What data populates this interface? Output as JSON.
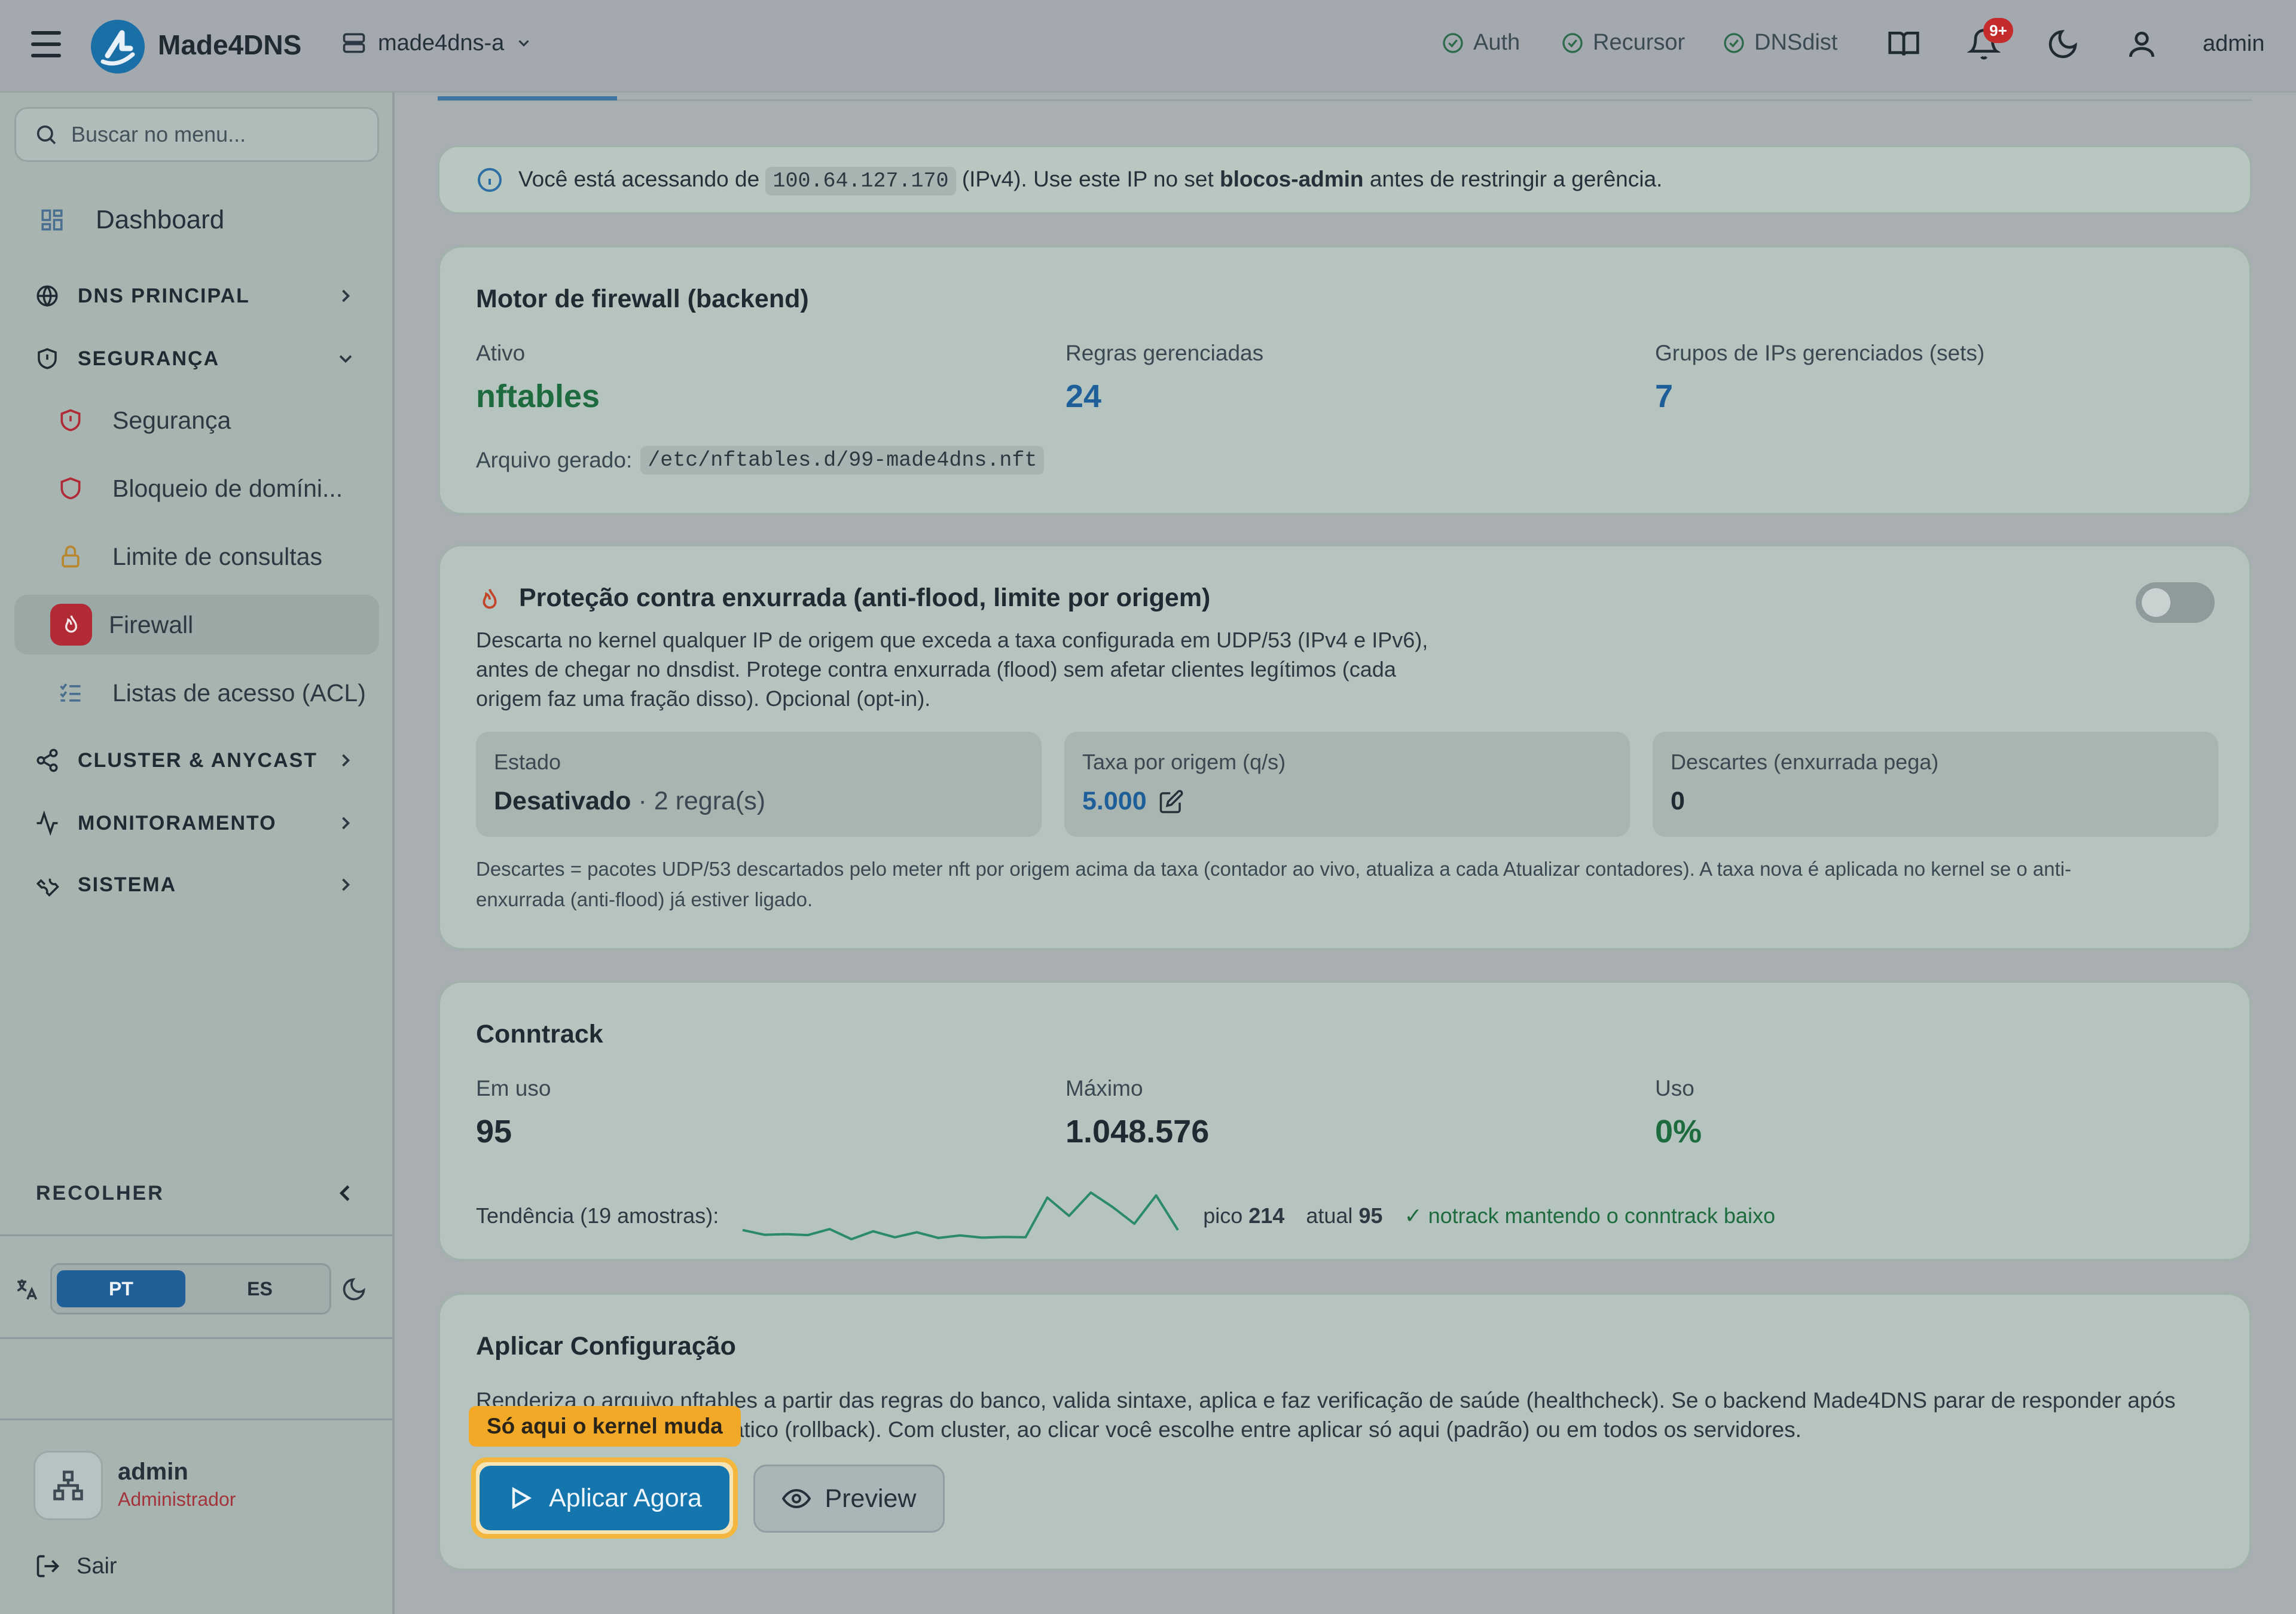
{
  "header": {
    "app_name": "Made4DNS",
    "server": "made4dns-a",
    "statuses": [
      "Auth",
      "Recursor",
      "DNSdist"
    ],
    "notif_count": "9+",
    "user": "admin"
  },
  "sidebar": {
    "search_placeholder": "Buscar no menu...",
    "dashboard": "Dashboard",
    "sections": {
      "dns": "DNS PRINCIPAL",
      "security": "SEGURANÇA",
      "cluster": "CLUSTER & ANYCAST",
      "monitoring": "MONITORAMENTO",
      "system": "SISTEMA"
    },
    "security_items": [
      "Segurança",
      "Bloqueio de domíni...",
      "Limite de consultas",
      "Firewall",
      "Listas de acesso (ACL)"
    ],
    "collapse": "RECOLHER",
    "lang": {
      "pt": "PT",
      "es": "ES"
    },
    "user": {
      "name": "admin",
      "role": "Administrador"
    },
    "logout": "Sair"
  },
  "info": {
    "before": "Você está acessando de",
    "ip": "100.64.127.170",
    "mid": "(IPv4). Use este IP no set",
    "set": "blocos-admin",
    "after": "antes de restringir a gerência."
  },
  "engine": {
    "title": "Motor de firewall (backend)",
    "active_label": "Ativo",
    "active_value": "nftables",
    "rules_label": "Regras gerenciadas",
    "rules_value": "24",
    "sets_label": "Grupos de IPs gerenciados (sets)",
    "sets_value": "7",
    "file_label": "Arquivo gerado:",
    "file_path": "/etc/nftables.d/99-made4dns.nft"
  },
  "antiflood": {
    "title": "Proteção contra enxurrada (anti-flood, limite por origem)",
    "desc_1": "Descarta no kernel qualquer IP de origem que exceda a taxa configurada em UDP/53 (IPv4 e IPv6),",
    "desc_2": "antes de chegar no dnsdist. Protege contra enxurrada (flood) sem afetar clientes legítimos (cada",
    "desc_3": "origem faz uma fração disso). Opcional (opt-in).",
    "state_label": "Estado",
    "state_value": "Desativado",
    "state_rules": "· 2 regra(s)",
    "rate_label": "Taxa por origem (q/s)",
    "rate_value": "5.000",
    "drops_label": "Descartes (enxurrada pega)",
    "drops_value": "0",
    "note_1": "Descartes = pacotes UDP/53 descartados pelo meter nft por origem acima da taxa (contador ao vivo, atualiza a cada Atualizar contadores). A taxa nova é aplicada no kernel se o anti-",
    "note_2": "enxurrada (anti-flood) já estiver ligado."
  },
  "conntrack": {
    "title": "Conntrack",
    "in_use_label": "Em uso",
    "in_use_value": "95",
    "max_label": "Máximo",
    "max_value": "1.048.576",
    "usage_label": "Uso",
    "usage_value": "0%",
    "trend_label": "Tendência (19 amostras):",
    "peak_label": "pico",
    "peak_value": "214",
    "current_label": "atual",
    "current_value": "95",
    "notrack_msg": "✓ notrack mantendo o conntrack baixo",
    "sparkline": [
      95,
      80,
      82,
      79,
      98,
      66,
      91,
      72,
      88,
      70,
      78,
      71,
      73,
      72,
      198,
      140,
      214,
      168,
      115,
      205,
      95
    ]
  },
  "apply": {
    "title": "Aplicar Configuração",
    "desc_1": "Renderiza o arquivo nftables a partir das regras do banco, valida sintaxe, aplica e faz verificação de saúde (healthcheck). Se o backend Made4DNS parar de responder após",
    "desc_2": "aplicar, faz rollback automático (rollback). Com cluster, ao clicar você escolhe entre aplicar só aqui (padrão) ou em todos os servidores.",
    "callout": "Só aqui o kernel muda",
    "apply_btn": "Aplicar Agora",
    "preview_btn": "Preview"
  },
  "colors": {
    "accent": "#1576ad",
    "active_red": "#b22a36",
    "success": "#1e6b40",
    "callout": "#f2a928"
  }
}
